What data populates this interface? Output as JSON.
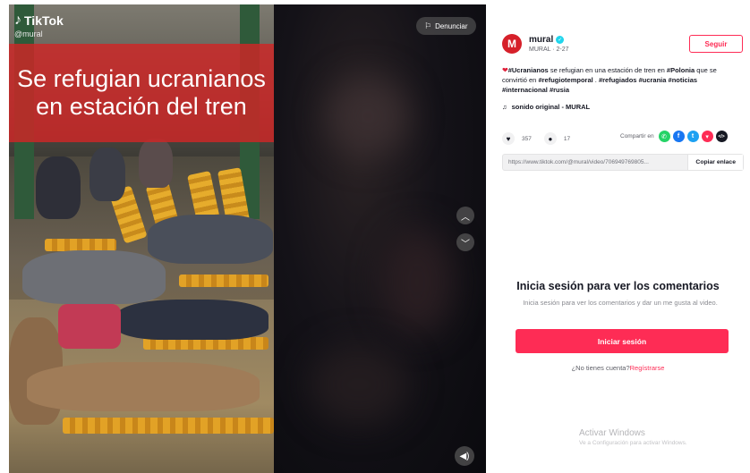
{
  "video": {
    "brand": "TikTok",
    "handle": "@mural",
    "overlay_title": "Se refugian ucranianos en estación del tren",
    "report_label": "Denunciar",
    "prev_icon": "chevron-up-icon",
    "next_icon": "chevron-down-icon",
    "sound_icon": "volume-icon"
  },
  "author": {
    "avatar_letter": "M",
    "name": "mural",
    "sub": "MURAL · 2-27",
    "follow_label": "Seguir"
  },
  "description": {
    "parts": [
      {
        "text": "#Ucranianos",
        "tag": true
      },
      {
        "text": " se refugian en una estación de tren en ",
        "tag": false
      },
      {
        "text": "#Polonia",
        "tag": true
      },
      {
        "text": " que se convirtió en ",
        "tag": false
      },
      {
        "text": "#refugiotemporal",
        "tag": true
      },
      {
        "text": " . ",
        "tag": false
      },
      {
        "text": "#refugiados",
        "tag": true
      },
      {
        "text": " ",
        "tag": false
      },
      {
        "text": "#ucrania",
        "tag": true
      },
      {
        "text": " ",
        "tag": false
      },
      {
        "text": "#noticias",
        "tag": true
      },
      {
        "text": " ",
        "tag": false
      },
      {
        "text": "#internacional",
        "tag": true
      },
      {
        "text": " ",
        "tag": false
      },
      {
        "text": "#rusia",
        "tag": true
      }
    ]
  },
  "sound": {
    "label": "sonido original - MURAL"
  },
  "stats": {
    "likes": "357",
    "comments": "17"
  },
  "share": {
    "label": "Compartir en",
    "icons": [
      {
        "name": "whatsapp-icon",
        "glyph": "✆",
        "color": "#25d366"
      },
      {
        "name": "facebook-icon",
        "glyph": "f",
        "color": "#1877f2"
      },
      {
        "name": "twitter-icon",
        "glyph": "t",
        "color": "#1da1f2"
      },
      {
        "name": "pinterest-icon",
        "glyph": "▾",
        "color": "#fe2c55"
      },
      {
        "name": "embed-icon",
        "glyph": "</>",
        "color": "#161823"
      }
    ]
  },
  "link": {
    "url": "https://www.tiktok.com/@mural/video/706949769805...",
    "copy_label": "Copiar enlace"
  },
  "login": {
    "title": "Inicia sesión para ver los comentarios",
    "subtitle": "Inicia sesión para ver los comentarios y dar un me gusta al video.",
    "button_label": "Iniciar sesión",
    "signup_prompt": "¿No tienes cuenta?",
    "signup_link": "Regístrarse"
  },
  "windows": {
    "title": "Activar Windows",
    "subtitle": "Ve a Configuración para activar Windows."
  },
  "colors": {
    "accent": "#fe2c55",
    "banner": "#d02626"
  }
}
